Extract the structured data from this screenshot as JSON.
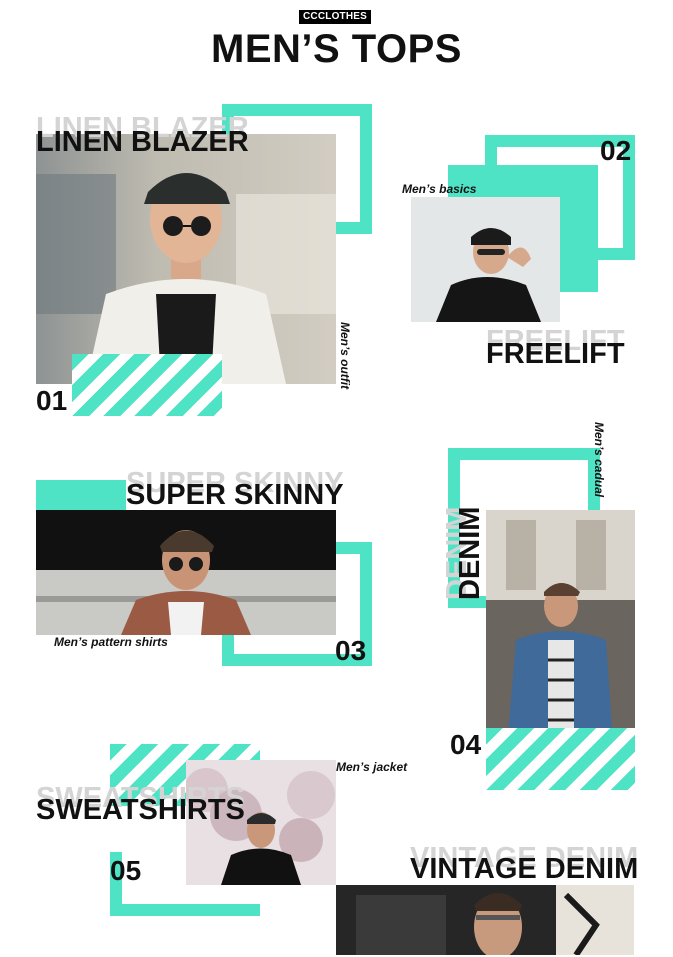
{
  "header": {
    "brand": "CCCLOTHES",
    "title": "MEN’S TOPS"
  },
  "items": [
    {
      "number": "01",
      "name": "LINEN BLAZER",
      "ghost": "LINEN BLAZER",
      "tag": "Men’s outfit"
    },
    {
      "number": "02",
      "name": "FREELIFT",
      "ghost": "FREELIFT",
      "tag": "Men’s basics"
    },
    {
      "number": "03",
      "name": "SUPER SKINNY",
      "ghost": "SUPER SKINNY",
      "tag": "Men’s pattern shirts"
    },
    {
      "number": "04",
      "name": "DENIM",
      "ghost": "DENIM",
      "tag": "Men’s cadual"
    },
    {
      "number": "05",
      "name": "SWEATSHIRTS",
      "ghost": "SWEATSHIRTS",
      "tag": "Men’s jacket"
    },
    {
      "number": "",
      "name": "VINTAGE DENIM",
      "ghost": "VINTAGE DENIM",
      "tag": ""
    }
  ],
  "colors": {
    "accent": "#4fe3c5",
    "text": "#111111",
    "ghost": "#d4d4d4"
  }
}
